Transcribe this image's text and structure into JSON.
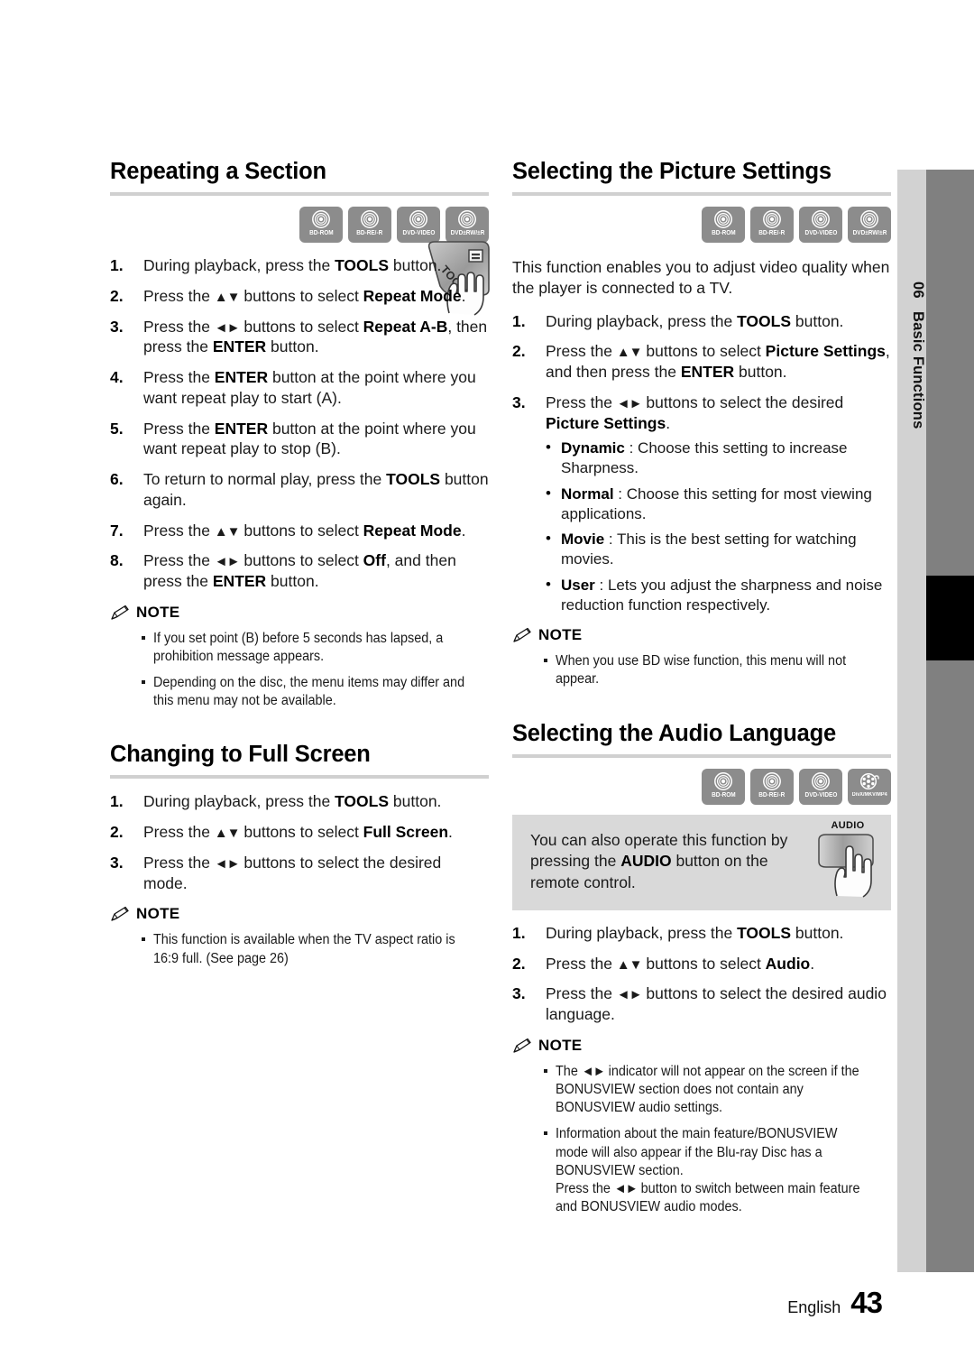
{
  "page": {
    "language_label": "English",
    "page_number": "43",
    "chapter_number": "06",
    "chapter_title": "Basic Functions"
  },
  "icons": {
    "note": "pencil-icon",
    "disc": "disc-icon",
    "film": "film-reel-icon",
    "tools_button": "tools-remote-button-icon",
    "audio_button": "audio-remote-button-icon"
  },
  "badges": {
    "bd_rom": "BD-ROM",
    "bd_re_r": "BD-RE/-R",
    "dvd_video": "DVD-VIDEO",
    "dvd_rw_r": "DVD±RW/±R",
    "divx": "DivX/MKV/MP4"
  },
  "note_label": "NOTE",
  "sections": {
    "repeating": {
      "title": "Repeating a Section",
      "steps": [
        "During playback, press the <b>TOOLS</b> button.",
        "Press the <span class=\"arrows\">▲▼</span> buttons to select <b>Repeat Mode</b>.",
        "Press the <span class=\"arrows\">◄►</span> buttons to select <b>Repeat A-B</b>, then press the <b>ENTER</b> button.",
        "Press the <b>ENTER</b> button at the point where you want repeat play to start (A).",
        "Press the <b>ENTER</b> button at the point where you want repeat play to stop (B).",
        "To return to normal play, press the <b>TOOLS</b> button again.",
        "Press the <span class=\"arrows\">▲▼</span> buttons to select <b>Repeat Mode</b>.",
        "Press the <span class=\"arrows\">◄►</span> buttons to select <b>Off</b>, and then press the <b>ENTER</b> button."
      ],
      "notes": [
        "If you set point (B) before 5 seconds has lapsed, a prohibition message appears.",
        "Depending on the disc, the menu items may differ and this menu may not be available."
      ]
    },
    "full_screen": {
      "title": "Changing to Full Screen",
      "steps": [
        "During playback, press the <b>TOOLS</b> button.",
        "Press the <span class=\"arrows\">▲▼</span> buttons to select <b>Full Screen</b>.",
        "Press the <span class=\"arrows\">◄►</span> buttons to select the desired mode."
      ],
      "notes": [
        "This function is available when the TV aspect ratio is 16:9 full. (See page 26)"
      ]
    },
    "picture_settings": {
      "title": "Selecting the Picture Settings",
      "intro": "This function enables you to adjust video quality when the player is connected to a TV.",
      "steps": [
        "During playback, press the <b>TOOLS</b> button.",
        "Press the <span class=\"arrows\">▲▼</span> buttons to select <b>Picture Settings</b>, and then press the <b>ENTER</b> button.",
        "Press the <span class=\"arrows\">◄►</span> buttons to select the desired <b>Picture Settings</b>."
      ],
      "options": [
        "<b>Dynamic</b> : Choose this setting to increase Sharpness.",
        "<b>Normal</b> : Choose this setting for most viewing applications.",
        "<b>Movie</b> : This is the best setting for watching movies.",
        "<b>User</b> : Lets you adjust the sharpness and noise reduction function respectively."
      ],
      "notes": [
        "When you use BD wise function, this menu will not appear."
      ]
    },
    "audio_language": {
      "title": "Selecting the Audio Language",
      "callout": "You can also operate this function by pressing the <b>AUDIO</b> button on the remote control.",
      "callout_button_label": "AUDIO",
      "steps": [
        "During playback, press the <b>TOOLS</b> button.",
        "Press the <span class=\"arrows\">▲▼</span> buttons to select <b>Audio</b>.",
        "Press the <span class=\"arrows\">◄►</span> buttons to select the desired audio language."
      ],
      "notes": [
        "The <span class=\"arrows\">◄►</span> indicator will not appear on the screen if the BONUSVIEW section does not contain any BONUSVIEW audio settings.",
        "Information about the main feature/BONUSVIEW mode will also appear if the Blu-ray Disc has a BONUSVIEW section.<br>Press the <span class=\"arrows\">◄►</span> button to switch between main feature and BONUSVIEW audio modes."
      ]
    }
  }
}
